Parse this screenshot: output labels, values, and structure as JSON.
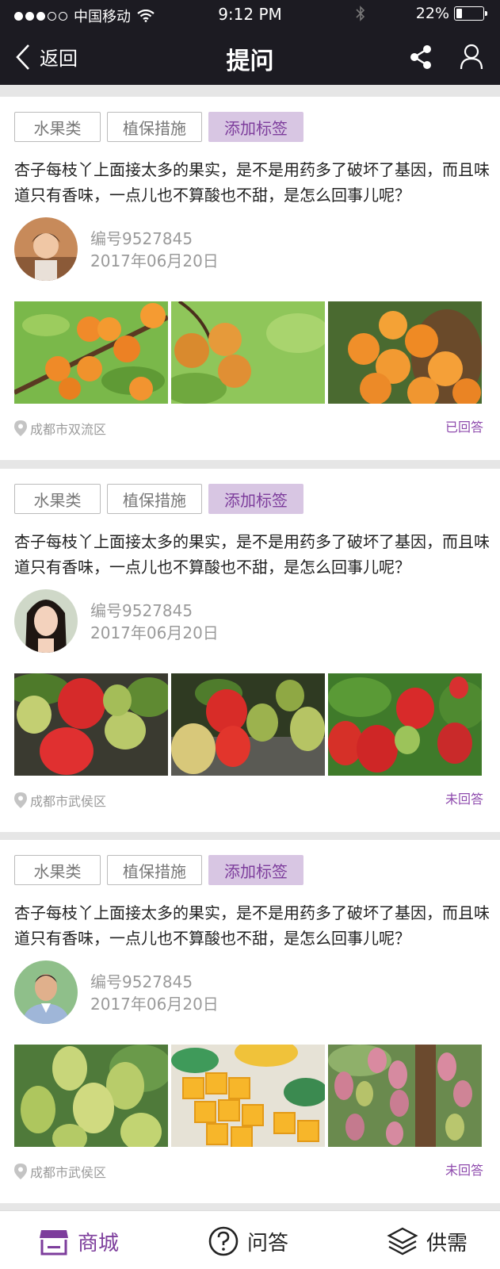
{
  "status": {
    "carrier": "中国移动",
    "time": "9:12 PM",
    "battery": "22%",
    "battery_level": 0.22
  },
  "header": {
    "back_label": "返回",
    "title": "提问"
  },
  "cards": [
    {
      "tags": [
        "水果类",
        "植保措施",
        "添加标签"
      ],
      "question": "杏子每枝丫上面接太多的果实，是不是用药多了破坏了基因，而且味道只有香味，一点儿也不算酸也不甜，是怎么回事儿呢？",
      "id": "编号9527845",
      "date": "2017年06月20日",
      "location": "成都市双流区",
      "answer_status": "已回答"
    },
    {
      "tags": [
        "水果类",
        "植保措施",
        "添加标签"
      ],
      "question": "杏子每枝丫上面接太多的果实，是不是用药多了破坏了基因，而且味道只有香味，一点儿也不算酸也不甜，是怎么回事儿呢？",
      "id": "编号9527845",
      "date": "2017年06月20日",
      "location": "成都市武侯区",
      "answer_status": "未回答"
    },
    {
      "tags": [
        "水果类",
        "植保措施",
        "添加标签"
      ],
      "question": "杏子每枝丫上面接太多的果实，是不是用药多了破坏了基因，而且味道只有香味，一点儿也不算酸也不甜，是怎么回事儿呢？",
      "id": "编号9527845",
      "date": "2017年06月20日",
      "location": "成都市武侯区",
      "answer_status": "未回答"
    }
  ],
  "tabbar": {
    "mall": "商城",
    "qa": "问答",
    "supply": "供需"
  },
  "colors": {
    "header_bg": "#1c1b22",
    "accent": "#7d3d9c",
    "tag_add_bg": "#d8c6e3"
  }
}
